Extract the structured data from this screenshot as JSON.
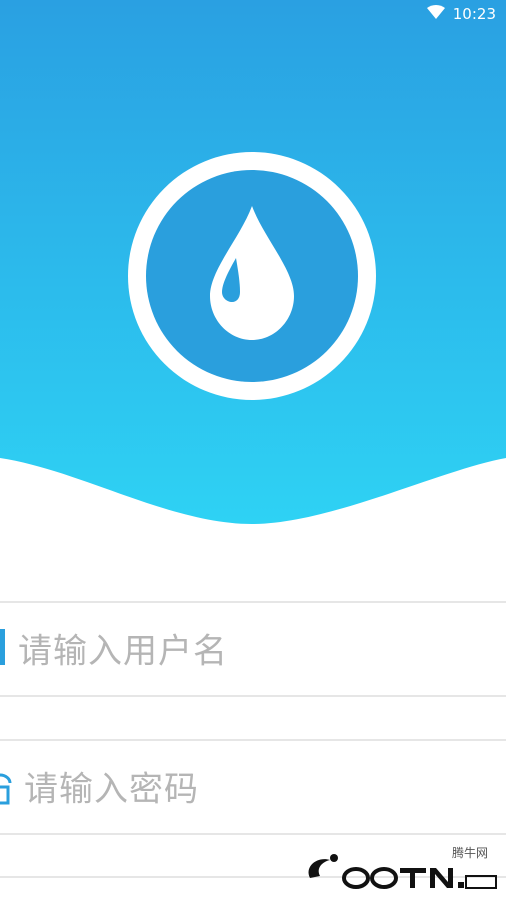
{
  "status_bar": {
    "time": "10:23",
    "wifi_icon": "wifi-icon"
  },
  "colors": {
    "header_top": "#2aa0e2",
    "header_bottom": "#2ec9f0",
    "logo_circle": "#2a9fdd",
    "placeholder": "#b5b5b5",
    "divider": "#e6e6e6",
    "icon_accent": "#2a9fdd"
  },
  "logo": {
    "icon": "water-drop-icon"
  },
  "login_form": {
    "username_placeholder": "请输入用户名",
    "username_icon": "user-icon",
    "password_placeholder": "请输入密码",
    "password_icon": "lock-icon"
  },
  "watermark": {
    "small_text": "腾牛网",
    "brand_text": "QQTN.com"
  }
}
